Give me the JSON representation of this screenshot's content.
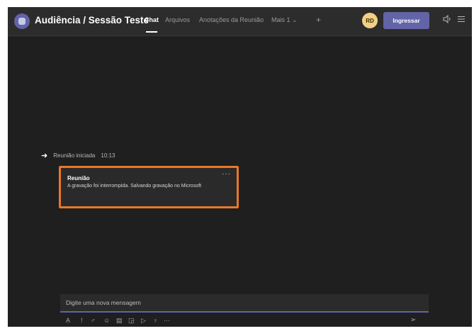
{
  "header": {
    "title": "Audiência / Sessão Teste",
    "tabs": [
      {
        "label": "Chat",
        "active": true
      },
      {
        "label": "Arquivos",
        "active": false
      },
      {
        "label": "Anotações da Reunião",
        "active": false
      },
      {
        "label": "Mais 1 ⌄",
        "active": false
      }
    ],
    "add_tab_icon": "plus-icon",
    "avatar_initials": "RD",
    "join_label": "Ingressar",
    "icons": [
      "device-audio-icon",
      "more-options-icon"
    ]
  },
  "chat": {
    "system_message": {
      "text": "Reunião iniciada",
      "time": "10:13"
    },
    "recording_card": {
      "title": "Reunião",
      "body": "A gravação foi interrompida. Salvando gravação no Microsoft",
      "more": "···"
    }
  },
  "compose": {
    "placeholder": "Digite uma nova mensagem",
    "toolbar_icons": [
      "format-icon",
      "attach-icon",
      "link-icon",
      "emoji-icon",
      "gif-icon",
      "sticker-icon",
      "meet-icon",
      "praise-icon",
      "more-icon"
    ],
    "send_icon": "send-icon"
  },
  "colors": {
    "accent": "#6264a7",
    "highlight": "#e8782a",
    "background": "#1f1f1f",
    "header": "#2d2c2c"
  }
}
